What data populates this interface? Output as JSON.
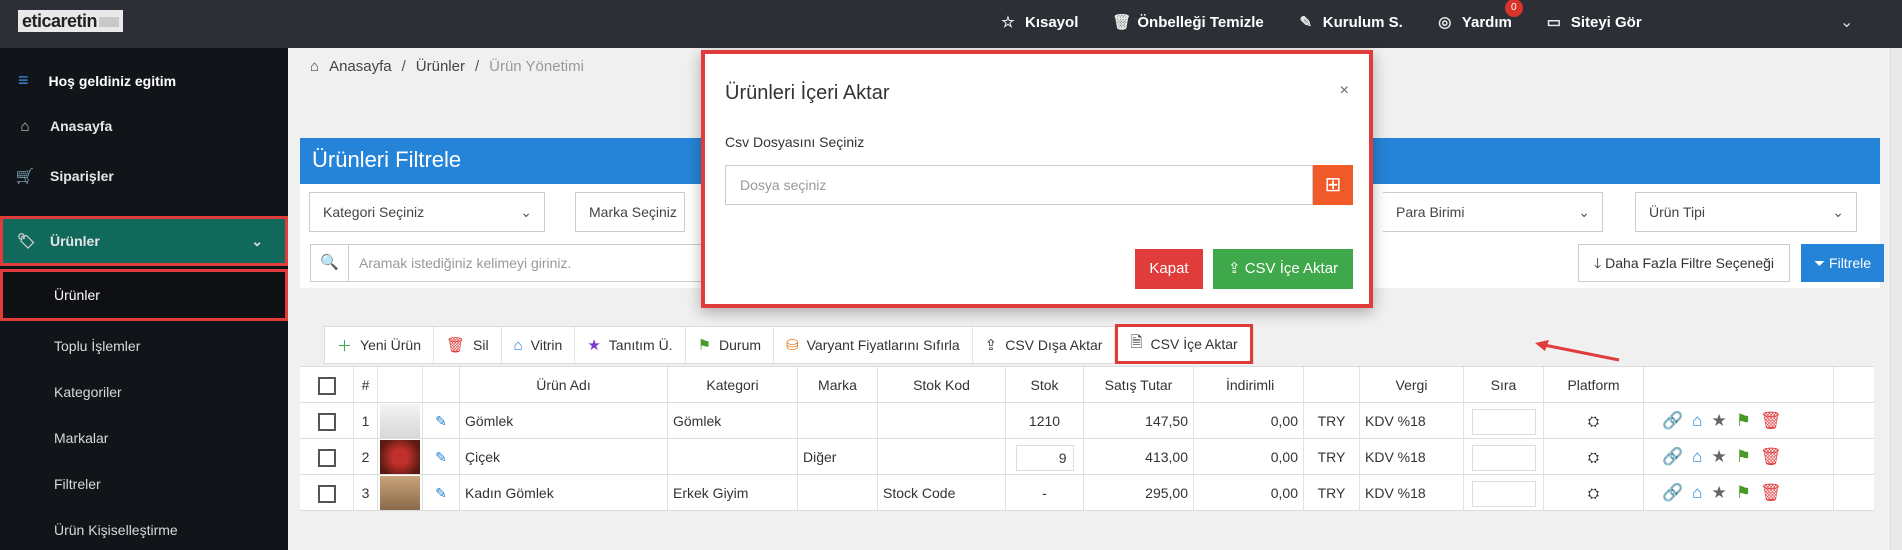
{
  "topbar": {
    "logo": "eticaretin",
    "items": [
      {
        "icon": "star-icon",
        "label": "Kısayol"
      },
      {
        "icon": "trash-icon",
        "label": "Önbelleği Temizle"
      },
      {
        "icon": "wand-icon",
        "label": "Kurulum S."
      },
      {
        "icon": "lifebuoy-icon",
        "label": "Yardım",
        "badge": "0"
      },
      {
        "icon": "monitor-icon",
        "label": "Siteyi Gör"
      }
    ]
  },
  "sidebar": {
    "welcome": "Hoş geldiniz egitim",
    "items": [
      {
        "label": "Anasayfa",
        "icon": "home-icon"
      },
      {
        "label": "Siparişler",
        "icon": "cart-icon"
      },
      {
        "label": "Ürünler",
        "icon": "tag-icon"
      }
    ],
    "subitems": [
      "Ürünler",
      "Toplu İşlemler",
      "Kategoriler",
      "Markalar",
      "Filtreler",
      "Ürün Kişiselleştirme"
    ]
  },
  "breadcrumb": {
    "home": "Anasayfa",
    "section": "Ürünler",
    "current": "Ürün Yönetimi"
  },
  "filter": {
    "title": "Ürünleri Filtrele",
    "category": "Kategori Seçiniz",
    "brand": "Marka Seçiniz",
    "currency": "Para Birimi",
    "product_type": "Ürün Tipi",
    "search_placeholder": "Aramak istediğiniz kelimeyi giriniz.",
    "more_button": "Daha Fazla Filtre Seçeneği",
    "filter_button": "Filtrele"
  },
  "toolbar": {
    "new": "Yeni Ürün",
    "delete": "Sil",
    "showcase": "Vitrin",
    "intro": "Tanıtım Ü.",
    "status": "Durum",
    "reset_prices": "Varyant Fiyatlarını Sıfırla",
    "export": "CSV Dışa Aktar",
    "import": "CSV İçe Aktar"
  },
  "table": {
    "headers": [
      "#",
      "Ürün Adı",
      "Kategori",
      "Marka",
      "Stok Kod",
      "Stok",
      "Satış Tutar",
      "İndirimli",
      "Vergi",
      "Sıra",
      "Platform"
    ],
    "rows": [
      {
        "no": "1",
        "name": "Gömlek",
        "category": "Gömlek",
        "brand": "",
        "code": "",
        "stock": "1210",
        "price": "147,50",
        "discount": "0,00",
        "currency": "TRY",
        "tax": "KDV %18"
      },
      {
        "no": "2",
        "name": "Çiçek",
        "category": "",
        "brand": "Diğer",
        "code": "",
        "stock": "9",
        "price": "413,00",
        "discount": "0,00",
        "currency": "TRY",
        "tax": "KDV %18"
      },
      {
        "no": "3",
        "name": "Kadın Gömlek",
        "category": "Erkek Giyim",
        "brand": "",
        "code": "Stock Code",
        "stock": "-",
        "price": "295,00",
        "discount": "0,00",
        "currency": "TRY",
        "tax": "KDV %18"
      }
    ]
  },
  "modal": {
    "title": "Ürünleri İçeri Aktar",
    "label": "Csv Dosyasını Seçiniz",
    "input_placeholder": "Dosya seçiniz",
    "close_button": "Kapat",
    "import_button": "CSV İçe Aktar"
  },
  "colors": {
    "topbar": "#2c3036",
    "sidebar": "#111418",
    "active": "#11695c",
    "primary": "#2584d8",
    "danger": "#e03c3c",
    "success": "#3fa84a",
    "orange": "#f05a28"
  }
}
